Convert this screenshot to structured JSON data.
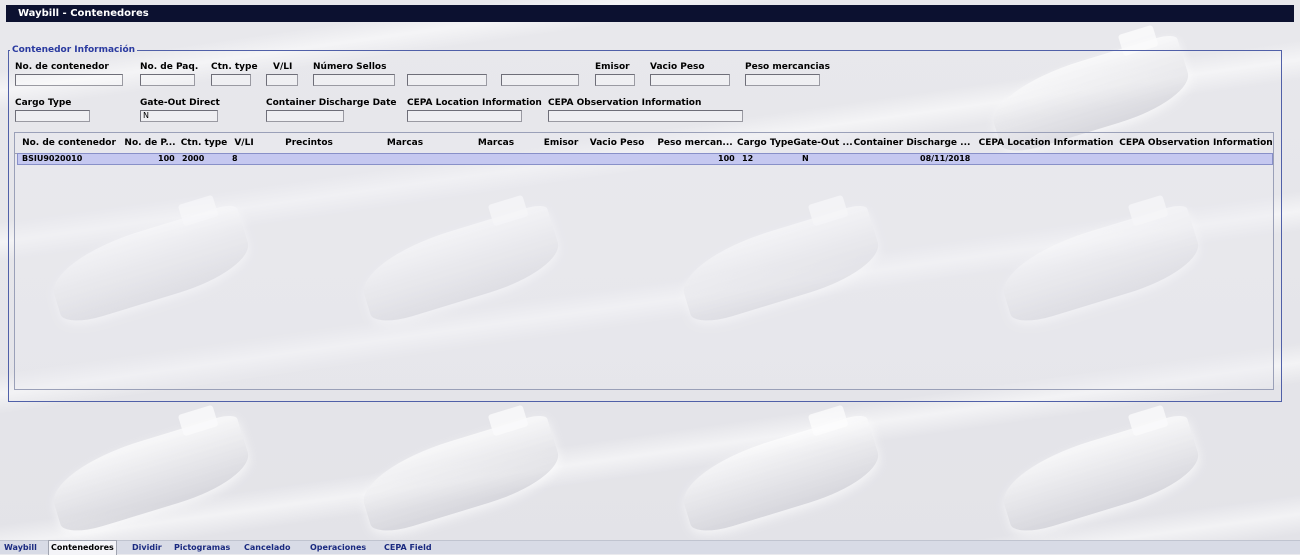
{
  "window": {
    "title": "Waybill - Contenedores"
  },
  "form": {
    "section_title": "Contenedor Información",
    "labels": {
      "container_no": "No. de contenedor",
      "packages": "No. de Paq.",
      "ctn_type": "Ctn. type",
      "vli": "V/LI",
      "seals": "Número Sellos",
      "emisor": "Emisor",
      "empty_weight": "Vacio Peso",
      "goods_weight": "Peso mercancias",
      "cargo_type": "Cargo Type",
      "gate_out": "Gate-Out Direct",
      "discharge_date": "Container Discharge Date",
      "cepa_location": "CEPA Location Information",
      "cepa_observation": "CEPA Observation Information"
    },
    "values": {
      "gate_out": "N"
    }
  },
  "grid": {
    "headers": [
      "No. de contenedor",
      "No. de P...",
      "Ctn. type",
      "V/LI",
      "Precintos",
      "Marcas",
      "Marcas",
      "Emisor",
      "Vacio Peso",
      "Peso mercan...",
      "Cargo Type",
      "Gate-Out ...",
      "Container Discharge ...",
      "CEPA Location Information",
      "CEPA Observation Information"
    ],
    "rows": [
      {
        "container_no": "BSIU9020010",
        "packages": "100",
        "ctn_type": "2000",
        "vli": "8",
        "goods_weight": "100",
        "cargo_type": "12",
        "gate_out": "N",
        "discharge_date": "08/11/2018"
      }
    ]
  },
  "tabs": [
    "Waybill",
    "Contenedores",
    "Dividir",
    "Pictogramas",
    "Cancelado",
    "Operaciones",
    "CEPA Field"
  ],
  "active_tab": "Contenedores",
  "colors": {
    "titlebar": "#0c1130",
    "legend_text": "#2a3aa0",
    "selected_row": "#c5c8f0"
  }
}
